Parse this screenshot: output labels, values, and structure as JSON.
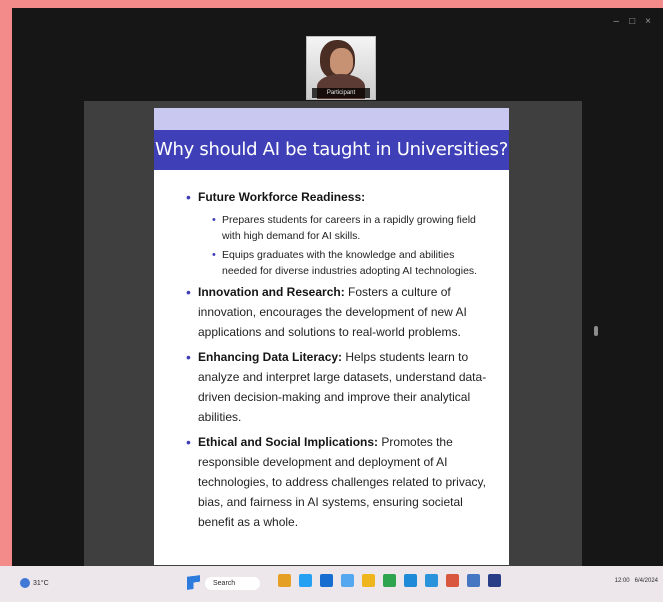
{
  "window": {
    "controls": [
      "–",
      "□",
      "×"
    ]
  },
  "participant": {
    "name": "Participant"
  },
  "slide": {
    "title": "Why should AI be taught in Universities?",
    "bullets": [
      {
        "heading": "Future Workforce Readiness:",
        "text": "",
        "subbullets": [
          "Prepares students for careers in a rapidly growing field with high demand for AI skills.",
          "Equips graduates with the knowledge and abilities needed for diverse industries adopting AI technologies."
        ]
      },
      {
        "heading": "Innovation and Research:",
        "text": "Fosters a culture of innovation, encourages the development of new AI applications and solutions to real-world problems."
      },
      {
        "heading": "Enhancing Data Literacy:",
        "text": "Helps students learn to analyze and interpret large datasets, understand data-driven decision-making and improve their analytical abilities."
      },
      {
        "heading": "Ethical and Social Implications:",
        "text": "Promotes the responsible development and deployment of AI technologies, to address challenges related to privacy, bias, and fairness in AI systems, ensuring societal benefit as a whole."
      }
    ]
  },
  "taskbar": {
    "weather_label": "31°C",
    "search_label": "Search",
    "apps": [
      "file-explorer-icon",
      "edge-icon",
      "word-icon",
      "store-icon",
      "files-icon",
      "chrome-icon",
      "teams-icon",
      "browser-icon",
      "paint-icon",
      "calendar-icon",
      "settings-icon"
    ],
    "time": "12:00",
    "date": "6/4/2024"
  },
  "colors": {
    "background": "#f48b8b",
    "title_bar": "#3f40b7",
    "slide_top": "#c8c8f1"
  }
}
